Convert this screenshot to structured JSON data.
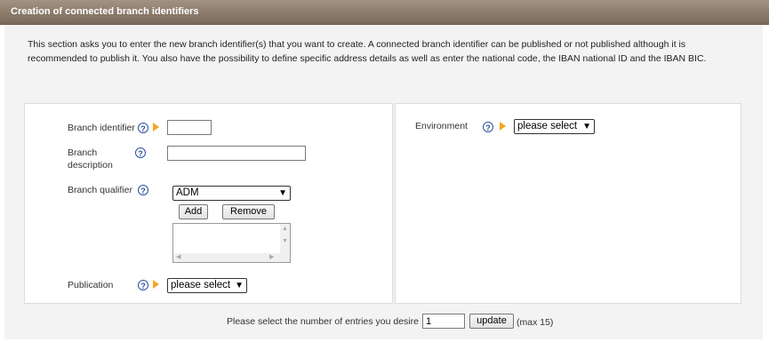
{
  "header": {
    "title": "Creation of connected branch identifiers"
  },
  "intro": {
    "line1": "This section asks you to enter the new branch identifier(s) that you want to create. A connected branch identifier can be published or not published although it is",
    "line2": "recommended to publish it. You also have the possibility to define specific address details as well as enter the national code, the IBAN national ID and the IBAN BIC."
  },
  "form": {
    "branch_identifier": {
      "label": "Branch identifier",
      "value": ""
    },
    "branch_description": {
      "label_line1": "Branch",
      "label_line2": "description",
      "value": ""
    },
    "branch_qualifier": {
      "label": "Branch qualifier",
      "selected": "ADM",
      "add_label": "Add",
      "remove_label": "Remove"
    },
    "publication": {
      "label": "Publication",
      "selected": "please select"
    },
    "environment": {
      "label": "Environment",
      "selected": "please select"
    },
    "help_glyph": "?"
  },
  "footer": {
    "entries_label": "Please select the number of entries you desire",
    "entries_value": "1",
    "update_label": "update",
    "max_note": "(max 15)"
  }
}
